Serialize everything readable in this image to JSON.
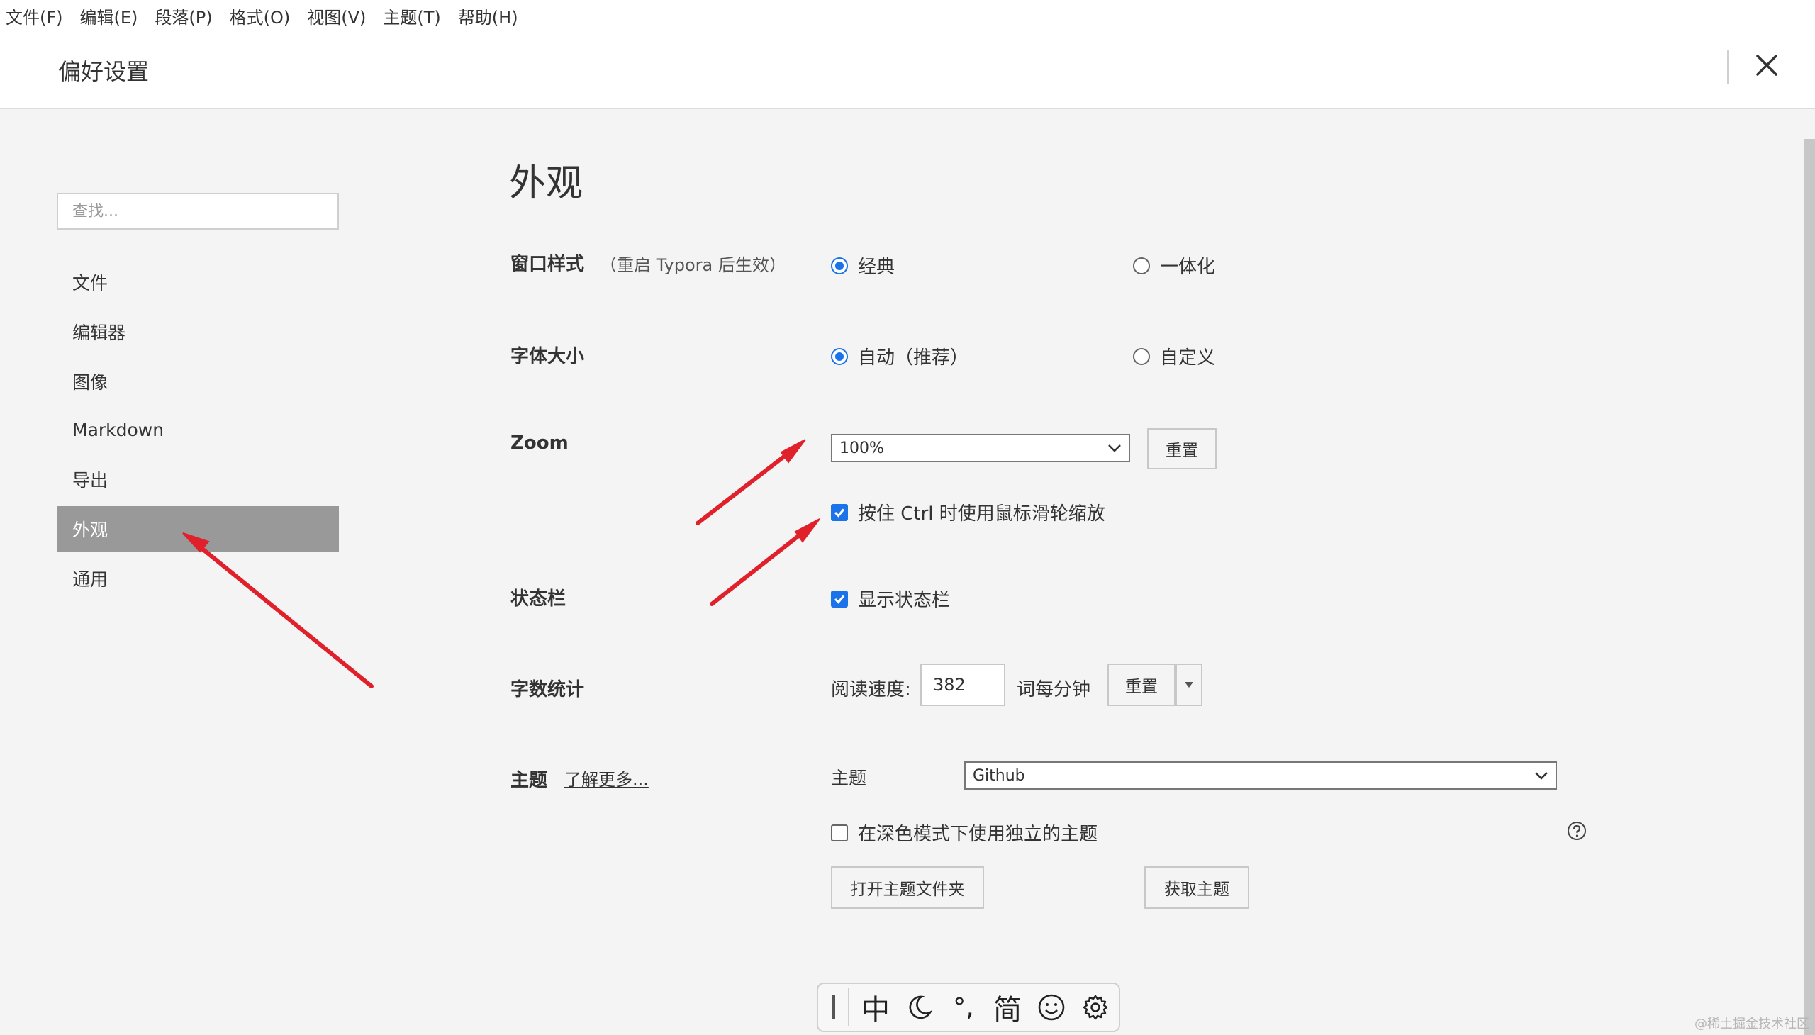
{
  "menubar": [
    "文件(F)",
    "编辑(E)",
    "段落(P)",
    "格式(O)",
    "视图(V)",
    "主题(T)",
    "帮助(H)"
  ],
  "dialog": {
    "title": "偏好设置"
  },
  "sidebar": {
    "search_placeholder": "查找...",
    "items": [
      "文件",
      "编辑器",
      "图像",
      "Markdown",
      "导出",
      "外观",
      "通用"
    ],
    "active": "外观"
  },
  "content": {
    "section_title": "外观",
    "window_style": {
      "label": "窗口样式",
      "note": "（重启 Typora 后生效）",
      "option_classic": "经典",
      "option_unified": "一体化",
      "selected": "经典"
    },
    "font_size": {
      "label": "字体大小",
      "option_auto": "自动（推荐）",
      "option_custom": "自定义",
      "selected": "自动（推荐）"
    },
    "zoom": {
      "label": "Zoom",
      "value": "100%",
      "reset": "重置",
      "ctrl_wheel": "按住 Ctrl 时使用鼠标滑轮缩放",
      "ctrl_wheel_checked": true
    },
    "status_bar": {
      "label": "状态栏",
      "show": "显示状态栏",
      "checked": true
    },
    "word_count": {
      "label": "字数统计",
      "reading_speed_label": "阅读速度:",
      "reading_speed_value": "382",
      "unit": "词每分钟",
      "reset": "重置"
    },
    "theme": {
      "label": "主题",
      "learn_more": "了解更多...",
      "theme_label": "主题",
      "theme_value": "Github",
      "dark_mode": "在深色模式下使用独立的主题",
      "dark_mode_checked": false,
      "open_folder": "打开主题文件夹",
      "get_themes": "获取主题"
    }
  },
  "ime_toolbar": {
    "lang": "中",
    "punct": "°,",
    "script": "简"
  },
  "watermark": "@稀土掘金技术社区",
  "colors": {
    "accent": "#1a73e8",
    "active_nav": "#999999",
    "annotation_arrow": "#e0202a"
  }
}
